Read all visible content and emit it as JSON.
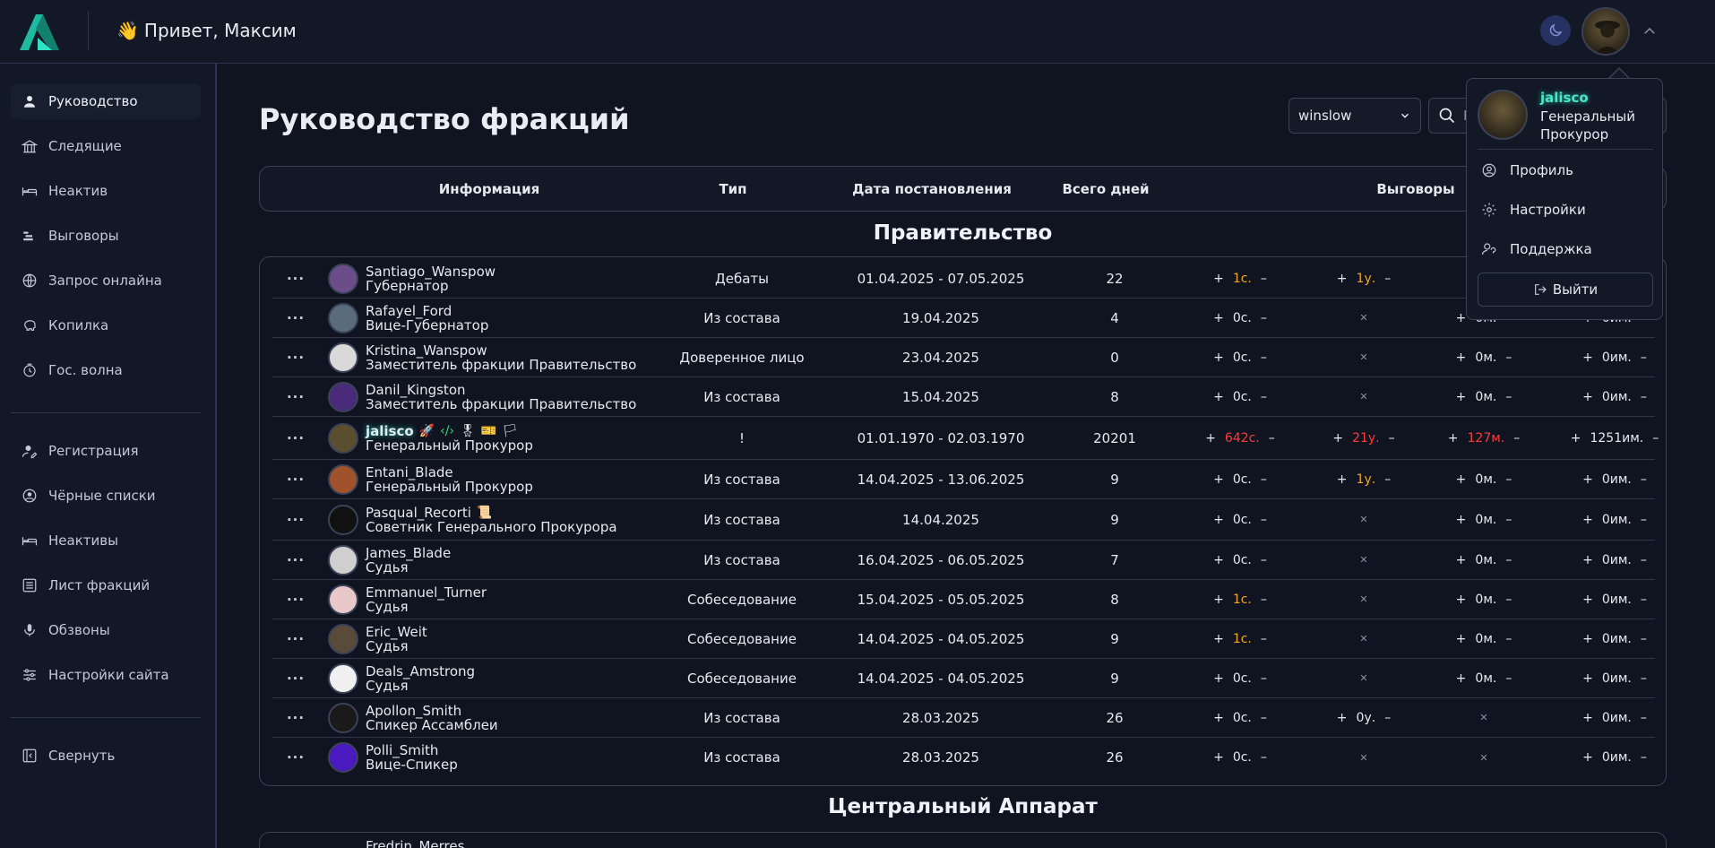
{
  "header": {
    "greeting_emoji": "👋",
    "greeting": "Привет, Максим"
  },
  "sidebar": {
    "items": [
      {
        "label": "Руководство",
        "icon": "user-icon"
      },
      {
        "label": "Следящие",
        "icon": "building-icon"
      },
      {
        "label": "Неактив",
        "icon": "bed-icon"
      },
      {
        "label": "Выговоры",
        "icon": "warning-stack-icon"
      },
      {
        "label": "Запрос онлайна",
        "icon": "globe-icon"
      },
      {
        "label": "Копилка",
        "icon": "piggy-bank-icon"
      },
      {
        "label": "Гос. волна",
        "icon": "clock-icon"
      }
    ],
    "items2": [
      {
        "label": "Регистрация",
        "icon": "user-edit-icon"
      },
      {
        "label": "Чёрные списки",
        "icon": "blacklist-icon"
      },
      {
        "label": "Неактивы",
        "icon": "bed-icon"
      },
      {
        "label": "Лист фракций",
        "icon": "list-icon"
      },
      {
        "label": "Обзвоны",
        "icon": "microphone-icon"
      },
      {
        "label": "Настройки сайта",
        "icon": "sliders-icon"
      }
    ],
    "collapse_label": "Свернуть"
  },
  "main": {
    "title": "Руководство фракций",
    "select_value": "winslow",
    "search_placeholder": "П",
    "columns": [
      "Информация",
      "Тип",
      "Дата постановления",
      "Всего дней",
      "Выговоры"
    ],
    "section1": "Правительство",
    "section2": "Центральный Аппарат",
    "rows": [
      {
        "name": "Santiago_Wanspow",
        "position": "Губернатор",
        "type": "Дебаты",
        "date": "01.04.2025 - 07.05.2025",
        "days": "22",
        "w1": "1с.",
        "w1c": "orange",
        "w2": "1у.",
        "w2c": "orange",
        "w3": "",
        "w4": "",
        "avatar": "#6b4d8a"
      },
      {
        "name": "Rafayel_Ford",
        "position": "Вице-Губернатор",
        "type": "Из состава",
        "date": "19.04.2025",
        "days": "4",
        "w1": "0с.",
        "w1c": "",
        "w2": "",
        "w2c": "",
        "w3": "0м.",
        "w4": "0им.",
        "avatar": "#5a6b7a"
      },
      {
        "name": "Kristina_Wanspow",
        "position": "Заместитель фракции Правительство",
        "type": "Доверенное лицо",
        "date": "23.04.2025",
        "days": "0",
        "w1": "0с.",
        "w1c": "",
        "w2": "",
        "w2c": "",
        "w3": "0м.",
        "w4": "0им.",
        "avatar": "#d9d9d9"
      },
      {
        "name": "Danil_Kingston",
        "position": "Заместитель фракции Правительство",
        "type": "Из состава",
        "date": "15.04.2025",
        "days": "8",
        "w1": "0с.",
        "w1c": "",
        "w2": "",
        "w2c": "",
        "w3": "0м.",
        "w4": "0им.",
        "avatar": "#4a2a7a"
      },
      {
        "name": "jalisco",
        "position": "Генеральный Прокурор",
        "type": "!",
        "date": "01.01.1970 - 02.03.1970",
        "days": "20201",
        "w1": "642с.",
        "w1c": "red",
        "w2": "21у.",
        "w2c": "red",
        "w3": "127м.",
        "w3c": "red",
        "w4": "1251им.",
        "avatar": "#5a4d30",
        "special": true
      },
      {
        "name": "Entani_Blade",
        "position": "Генеральный Прокурор",
        "type": "Из состава",
        "date": "14.04.2025 - 13.06.2025",
        "days": "9",
        "w1": "0с.",
        "w1c": "",
        "w2": "1у.",
        "w2c": "orange",
        "w3": "0м.",
        "w4": "0им.",
        "avatar": "#a0522d"
      },
      {
        "name": "Pasqual_Recorti",
        "position": "Советник Генерального Прокурора",
        "type": "Из состава",
        "date": "14.04.2025",
        "days": "9",
        "w1": "0с.",
        "w1c": "",
        "w2": "",
        "w2c": "",
        "w3": "0м.",
        "w4": "0им.",
        "avatar": "#111111",
        "badge": "📜"
      },
      {
        "name": "James_Blade",
        "position": "Судья",
        "type": "Из состава",
        "date": "16.04.2025 - 06.05.2025",
        "days": "7",
        "w1": "0с.",
        "w1c": "",
        "w2": "",
        "w2c": "",
        "w3": "0м.",
        "w4": "0им.",
        "avatar": "#cfcfcf"
      },
      {
        "name": "Emmanuel_Turner",
        "position": "Судья",
        "type": "Собеседование",
        "date": "15.04.2025 - 05.05.2025",
        "days": "8",
        "w1": "1с.",
        "w1c": "orange",
        "w2": "",
        "w2c": "",
        "w3": "0м.",
        "w4": "0им.",
        "avatar": "#e8c8c8"
      },
      {
        "name": "Eric_Weit",
        "position": "Судья",
        "type": "Собеседование",
        "date": "14.04.2025 - 04.05.2025",
        "days": "9",
        "w1": "1с.",
        "w1c": "orange",
        "w2": "",
        "w2c": "",
        "w3": "0м.",
        "w4": "0им.",
        "avatar": "#5a4a3a"
      },
      {
        "name": "Deals_Amstrong",
        "position": "Судья",
        "type": "Собеседование",
        "date": "14.04.2025 - 04.05.2025",
        "days": "9",
        "w1": "0с.",
        "w1c": "",
        "w2": "",
        "w2c": "",
        "w3": "0м.",
        "w4": "0им.",
        "avatar": "#f0f0f0"
      },
      {
        "name": "Apollon_Smith",
        "position": "Спикер Ассамблеи",
        "type": "Из состава",
        "date": "28.03.2025",
        "days": "26",
        "w1": "0с.",
        "w1c": "",
        "w2": "0у.",
        "w2c": "",
        "w3": "",
        "w4": "0им.",
        "avatar": "#1a1a1a"
      },
      {
        "name": "Polli_Smith",
        "position": "Вице-Спикер",
        "type": "Из состава",
        "date": "28.03.2025",
        "days": "26",
        "w1": "0с.",
        "w1c": "",
        "w2": "",
        "w2c": "",
        "w3": "",
        "w4": "0им.",
        "avatar": "#4a1ac0"
      }
    ],
    "next_row_name": "Fredrin_Merres"
  },
  "dropdown": {
    "name": "jalisco",
    "role": "Генеральный Прокурор",
    "items": [
      {
        "label": "Профиль",
        "icon": "profile-icon"
      },
      {
        "label": "Настройки",
        "icon": "settings-icon"
      },
      {
        "label": "Поддержка",
        "icon": "support-icon"
      }
    ],
    "logout": "Выйти"
  },
  "colors": {
    "accent": "#1fb9a0",
    "warn_orange": "#f5a623",
    "warn_red": "#ff3b3b"
  }
}
